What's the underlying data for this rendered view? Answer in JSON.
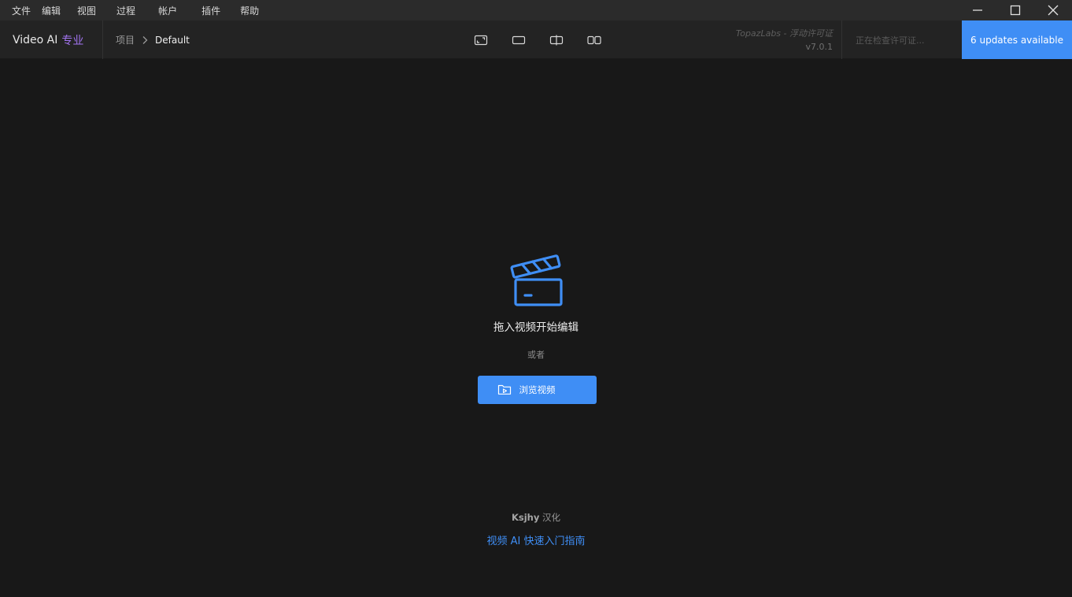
{
  "menubar": {
    "items": [
      {
        "label": "文件"
      },
      {
        "label": "编辑"
      },
      {
        "label": "视图"
      },
      {
        "label": "过程"
      },
      {
        "label": "帐户"
      },
      {
        "label": "插件"
      },
      {
        "label": "帮助"
      }
    ],
    "window_controls": [
      "minimize-icon",
      "maximize-icon",
      "close-icon"
    ]
  },
  "header": {
    "app_name": "Video AI",
    "edition": "专业",
    "breadcrumb": {
      "root": "项目",
      "current": "Default"
    },
    "view_modes": [
      "single-view-icon",
      "fullscreen-view-icon",
      "split-view-icon",
      "side-by-side-view-icon"
    ],
    "license_float": "TopazLabs - 浮动许可证",
    "version": "v7.0.1",
    "license_check": "正在检查许可证...",
    "updates_button": "6 updates available"
  },
  "main": {
    "drop_title": "拖入视频开始编辑",
    "or_text": "或者",
    "browse_button": "浏览视频",
    "credit_name": "Ksjhy",
    "credit_suffix": "汉化",
    "guide_link": "视频 AI 快速入门指南"
  },
  "colors": {
    "accent": "#3f8ef5",
    "edition": "#a274f0",
    "background": "#181818",
    "header": "#232323",
    "menubar": "#2b2b2b"
  }
}
